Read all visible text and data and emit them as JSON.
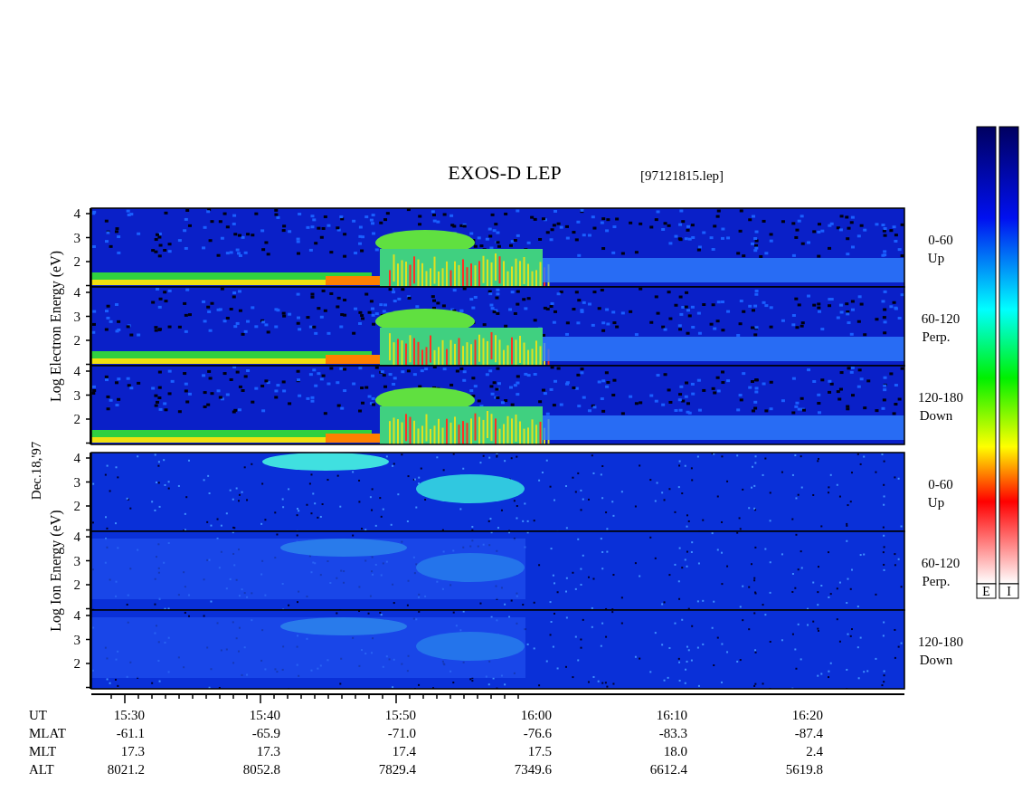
{
  "title": "EXOS-D LEP",
  "file": "[97121815.lep]",
  "date": "Dec.18,'97",
  "groups": [
    {
      "kind": "electron",
      "label": "Log Electron Energy (eV)",
      "panels": [
        {
          "range": "0-60",
          "direction": "Up",
          "ticks": [
            "4",
            "3",
            "2"
          ]
        },
        {
          "range": "60-120",
          "direction": "Perp.",
          "ticks": [
            "4",
            "3",
            "2"
          ]
        },
        {
          "range": "120-180",
          "direction": "Down",
          "ticks": [
            "4",
            "3",
            "2"
          ]
        }
      ]
    },
    {
      "kind": "ion",
      "label": "Log Ion Energy (eV)",
      "panels": [
        {
          "range": "0-60",
          "direction": "Up",
          "ticks": [
            "4",
            "3",
            "2"
          ]
        },
        {
          "range": "60-120",
          "direction": "Perp.",
          "ticks": [
            "4",
            "3",
            "2"
          ]
        },
        {
          "range": "120-180",
          "direction": "Down",
          "ticks": [
            "4",
            "3",
            "2"
          ]
        }
      ]
    }
  ],
  "time_axis": [
    {
      "name": "UT",
      "values": [
        "15:30",
        "15:40",
        "15:50",
        "16:00",
        "16:10",
        "16:20"
      ]
    },
    {
      "name": "MLAT",
      "values": [
        "-61.1",
        "-65.9",
        "-71.0",
        "-76.6",
        "-83.3",
        "-87.4"
      ]
    },
    {
      "name": "MLT",
      "values": [
        "17.3",
        "17.3",
        "17.4",
        "17.5",
        "18.0",
        "2.4"
      ]
    },
    {
      "name": "ALT",
      "values": [
        "8021.2",
        "8052.8",
        "7829.4",
        "7349.6",
        "6612.4",
        "5619.8"
      ]
    }
  ],
  "color_scales": [
    {
      "label": "E"
    },
    {
      "label": "I"
    }
  ]
}
